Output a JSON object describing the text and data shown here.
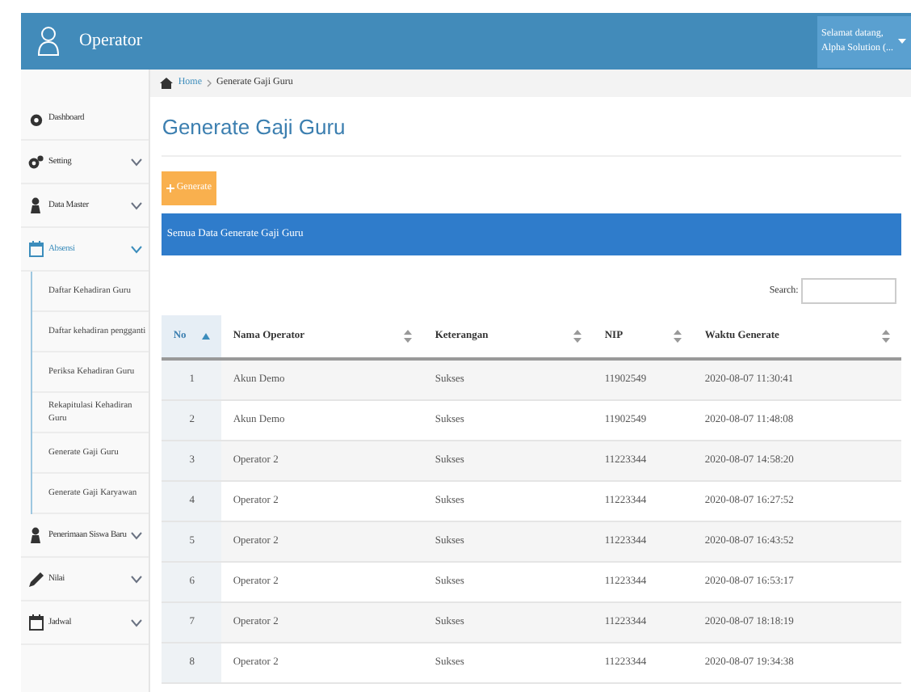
{
  "header": {
    "title": "Operator",
    "greeting": "Selamat datang,",
    "user": "Alpha Solution (..."
  },
  "breadcrumb": [
    {
      "label": "Home",
      "kind": "link"
    },
    {
      "label": "Generate Gaji Guru",
      "kind": "current"
    }
  ],
  "sidebar": {
    "items": [
      {
        "label": "Dashboard",
        "kind": "dashboard"
      },
      {
        "label": "Setting",
        "kind": "gears",
        "expanded": false
      },
      {
        "label": "Data Master",
        "kind": "person",
        "expanded": false
      },
      {
        "label": "Absensi",
        "kind": "calendar",
        "expanded": true,
        "children": [
          {
            "label": "Daftar Kehadiran Guru"
          },
          {
            "label": "Daftar kehadiran pengganti"
          },
          {
            "label": "Periksa Kehadiran Guru"
          },
          {
            "label": "Rekapitulasi Kehadiran Guru"
          },
          {
            "label": "Generate Gaji Guru"
          },
          {
            "label": "Generate Gaji Karyawan"
          }
        ]
      },
      {
        "label": "Penerimaan Siswa Baru",
        "kind": "person",
        "expanded": false
      },
      {
        "label": "Nilai",
        "kind": "pencil",
        "expanded": false
      },
      {
        "label": "Jadwal",
        "kind": "calendar",
        "expanded": false
      }
    ]
  },
  "page_title": "Generate Gaji Guru",
  "generate_button": "Generate",
  "panel_title": "Semua Data Generate Gaji Guru",
  "search": {
    "label": "Search:"
  },
  "table": {
    "columns": [
      {
        "label": "No",
        "selected": true
      },
      {
        "label": "Nama Operator",
        "selected": false
      },
      {
        "label": "Keterangan",
        "selected": false
      },
      {
        "label": "NIP",
        "selected": false
      },
      {
        "label": "Waktu Generate",
        "selected": false
      }
    ],
    "rows": [
      [
        "1",
        "Akun Demo",
        "Sukses",
        "11902549",
        "2020-08-07 11:30:41"
      ],
      [
        "2",
        "Akun Demo",
        "Sukses",
        "11902549",
        "2020-08-07 11:48:08"
      ],
      [
        "3",
        "Operator 2",
        "Sukses",
        "11223344",
        "2020-08-07 14:58:20"
      ],
      [
        "4",
        "Operator 2",
        "Sukses",
        "11223344",
        "2020-08-07 16:27:52"
      ],
      [
        "5",
        "Operator 2",
        "Sukses",
        "11223344",
        "2020-08-07 16:43:52"
      ],
      [
        "6",
        "Operator 2",
        "Sukses",
        "11223344",
        "2020-08-07 16:53:17"
      ],
      [
        "7",
        "Operator 2",
        "Sukses",
        "11223344",
        "2020-08-07 18:18:19"
      ],
      [
        "8",
        "Operator 2",
        "Sukses",
        "11223344",
        "2020-08-07 19:34:38"
      ]
    ]
  }
}
